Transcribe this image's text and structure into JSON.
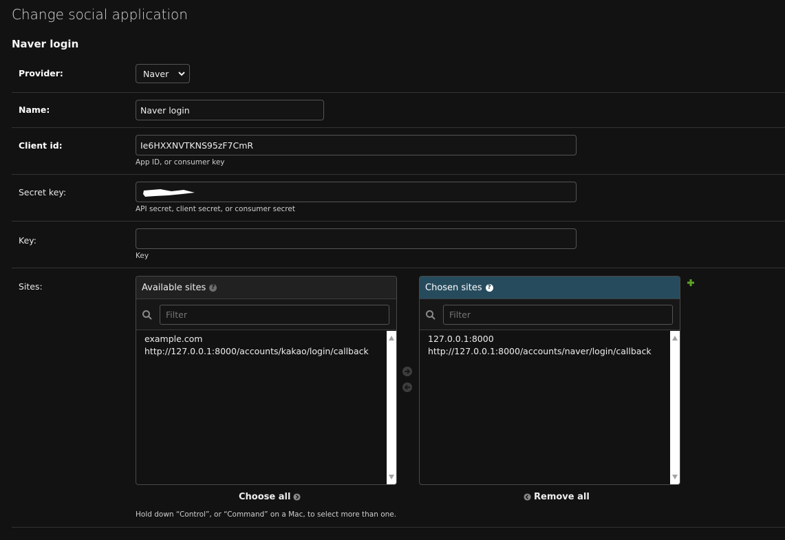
{
  "page": {
    "title": "Change social application"
  },
  "fieldset": {
    "title": "Naver login"
  },
  "provider": {
    "label": "Provider:",
    "value": "Naver"
  },
  "name": {
    "label": "Name:",
    "value": "Naver login"
  },
  "client_id": {
    "label": "Client id:",
    "value": "Ie6HXXNVTKNS95zF7CmR",
    "help": "App ID, or consumer key"
  },
  "secret_key": {
    "label": "Secret key:",
    "value": "",
    "help": "API secret, client secret, or consumer secret"
  },
  "key": {
    "label": "Key:",
    "value": "",
    "help": "Key"
  },
  "sites": {
    "label": "Sites:",
    "available": {
      "title": "Available sites",
      "filter_placeholder": "Filter",
      "items": [
        "example.com",
        "http://127.0.0.1:8000/accounts/kakao/login/callback"
      ],
      "choose_all": "Choose all"
    },
    "chosen": {
      "title": "Chosen sites",
      "filter_placeholder": "Filter",
      "items": [
        "127.0.0.1:8000",
        "http://127.0.0.1:8000/accounts/naver/login/callback"
      ],
      "remove_all": "Remove all"
    },
    "help": "Hold down “Control”, or “Command” on a Mac, to select more than one."
  },
  "colors": {
    "background": "#121212",
    "chosen_header": "#264b5d",
    "add_green": "#5fa225"
  },
  "icons": [
    "chevron-down-icon",
    "help-icon",
    "search-icon",
    "arrow-right-icon",
    "arrow-left-icon",
    "add-icon"
  ]
}
